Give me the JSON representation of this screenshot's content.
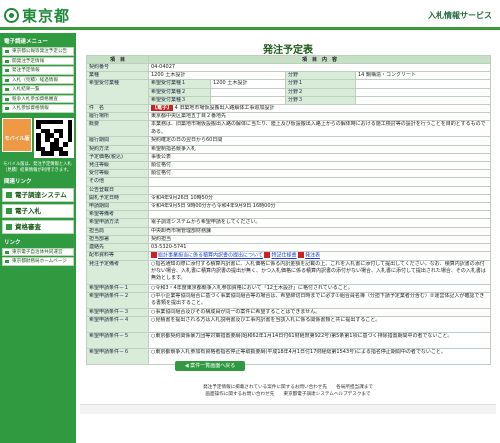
{
  "header": {
    "logo": "東京都",
    "service": "入札情報サービス"
  },
  "sidebar": {
    "menu_title": "電子調達メニュー",
    "items": [
      "東京都公報等発注予定公告",
      "開発注予定情報",
      "発注予定情報",
      "入札（見積）経過情報",
      "入札結果一覧",
      "競争入札参加資格審査",
      "入札参加資格情報"
    ],
    "mobile_label": "モバイル版",
    "mobile_note": "モバイル版は、発注予定情報と入札（見積）結果情報が利用できます。",
    "links_title": "関連リンク",
    "big_links": [
      "電子調達システム(TOP)",
      "電子入札",
      "資格審査"
    ],
    "bottom_links_title": "リンク",
    "bottom_links": [
      "東京電子自治体共同運営",
      "東京都財務局ホームページ"
    ]
  },
  "main": {
    "title": "発注予定表",
    "col_item": "項　目",
    "col_content": "項　目　内　容",
    "rows": [
      {
        "label": "契約番号",
        "value": "04-04027"
      },
      {
        "label": "業種",
        "value": "1200 土木設計",
        "sub_label": "分野",
        "sub_value": "14 鋼構造・コンクリート"
      },
      {
        "label": "希望受付業種",
        "g1": "希望受付業種１",
        "v1": "1200 土木設計",
        "s1": "分野１",
        "g2": "希望受付業種２",
        "s2": "分野２",
        "g3": "希望受付業種３",
        "s3": "分野３"
      },
      {
        "label": "件　名",
        "badge": "【電子】",
        "value": "4 旧築地市場仮設搬出入路解体工事追加設計"
      },
      {
        "label": "履行場所",
        "value": "東京都中央区築地五丁目２番地先"
      },
      {
        "label": "概要",
        "value": "本業務は、旧築地市場仮設搬出入路の解体に当たり、陸上及び仮設搬出入路上からの解体時における施工検討等の設計を行うことを目的とするものである。"
      },
      {
        "label": "履行期間",
        "value": "契約確定の日の翌日から60日間"
      },
      {
        "label": "契約方法",
        "value": "希望制指名競争入札"
      },
      {
        "label": "予定価格(税込)",
        "value": "事後公表"
      },
      {
        "label": "発注等級",
        "value": "順位格付"
      },
      {
        "label": "受付等級",
        "value": "順位格付"
      },
      {
        "label": "その他",
        "value": ""
      },
      {
        "label": "公告登載日",
        "value": ""
      },
      {
        "label": "開札予定日時",
        "value": "令和4年9月26日 10時50分"
      },
      {
        "label": "申請期間",
        "value": "令和4年9月5日 9時00分から令和4年9月9日 16時00分"
      },
      {
        "label": "希望等備考",
        "value": ""
      },
      {
        "label": "希望申請方法",
        "value": "電子調達システムから希望申請をしてください。"
      },
      {
        "label": "担当局",
        "value": "中央卸売市場管理部財務課"
      },
      {
        "label": "担当部署",
        "value": "契約担当"
      },
      {
        "label": "連絡先",
        "value": "03-5320-5741"
      },
      {
        "label": "配布資料等",
        "file1": "総計事業担当に係る積算内訳書の提出について",
        "file2": "特記仕様書",
        "file3": "発注表"
      },
      {
        "label": "発注予定備考",
        "value": "○指名通知の際に添付する積算内訳書に、入札価格に係る内訳金額を記載の上、これを入札書に添付して提出してください。なお、積算内訳書の添付がない場合、入札書に積算内訳書の提出が無く、かつ入札価格に係る積算内訳書の添付がない場合、入札書に添付して提出された場合、その入札書は無効とします。"
      },
      {
        "label": "希望申請条件－１",
        "value": "○令和3・4年度東京都競争入札参加資格において「12土木設計」に格付されていること。"
      },
      {
        "label": "希望申請条件－２",
        "value": "○中小企業等協同組合に基づく事業協同組合等の場合は、希望締切日時までに必ず①組合員名簿（分担下請予定業者分含む）②運営体記入が確認できる書類を提出すること。"
      },
      {
        "label": "希望申請条件－３",
        "value": "○事業協同組合及びその構成員が同一の案件に希望することはできません。"
      },
      {
        "label": "希望申請条件－４",
        "value": "○見積書を提出される方は入札説明書及び工事内訳書を当該入札に係る関係書類と共に提出すること。"
      },
      {
        "label": "希望申請条件－５",
        "value": "○東京都契約関係暴力団等対策措置要綱(昭和62年1月14日付61財経庶第922号)第5条第1項に基づく排除措置期間中の者でないこと。"
      },
      {
        "label": "希望申請条件－６",
        "value": "○東京都競争入札参加有資格者指名停止等取扱要綱(平成18年4月1日付17財経総第1543号)による指名停止期間中の者でないこと。"
      }
    ],
    "back_button": "◀ 案件一覧画面へ戻る"
  },
  "footer": {
    "line1": "発注予定情報に掲載されている案件に関するお問い合わせ先　　各局所担当課まで",
    "line2": "画面操作に関するお問い合わせ先　　東京都電子調達システムヘルプデスクまで"
  }
}
